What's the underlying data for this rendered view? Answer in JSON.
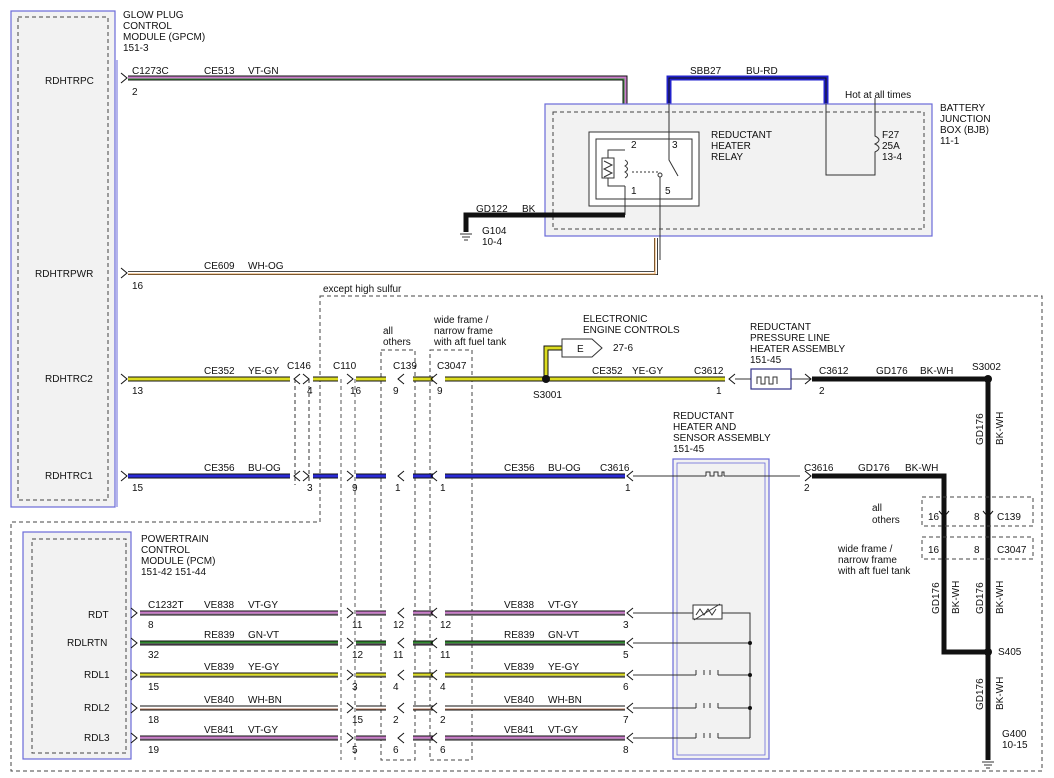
{
  "gpcm": {
    "l1": "GLOW PLUG",
    "l2": "CONTROL",
    "l3": "MODULE (GPCM)",
    "l4": "151-3"
  },
  "pcm": {
    "l1": "POWERTRAIN",
    "l2": "CONTROL",
    "l3": "MODULE (PCM)",
    "l4": "151-42   151-44"
  },
  "bjb": {
    "l1": "BATTERY",
    "l2": "JUNCTION",
    "l3": "BOX (BJB)",
    "l4": "11-1"
  },
  "relay": {
    "l1": "REDUCTANT",
    "l2": "HEATER",
    "l3": "RELAY",
    "p2": "2",
    "p3": "3",
    "p1": "1",
    "p5": "5"
  },
  "fuse": {
    "l1": "F27",
    "l2": "25A",
    "l3": "13-4"
  },
  "hot": "Hot at all times",
  "sbb": {
    "circuit": "SBB27",
    "color": "BU-RD"
  },
  "gd122": {
    "circuit": "GD122",
    "color": "BK"
  },
  "g104": {
    "l1": "G104",
    "l2": "10-4"
  },
  "pins": {
    "rdhtrpc": "RDHTRPC",
    "rdhtrpwr": "RDHTRPWR",
    "rdhtrc2": "RDHTRC2",
    "rdhtrc1": "RDHTRC1",
    "rdt": "RDT",
    "rdlrtn": "RDLRTN",
    "rdl1": "RDL1",
    "rdl2": "RDL2",
    "rdl3": "RDL3"
  },
  "w_ce513": {
    "conn": "C1273C",
    "circuit": "CE513",
    "color": "VT-GN",
    "pin": "2"
  },
  "w_ce609": {
    "circuit": "CE609",
    "color": "WH-OG",
    "pin": "16"
  },
  "except": "except high sulfur",
  "allothers": {
    "l1": "all",
    "l2": "others"
  },
  "wideframe": {
    "l1": "wide frame /",
    "l2": "narrow frame",
    "l3": "with aft fuel tank"
  },
  "eec": {
    "l1": "ELECTRONIC",
    "l2": "ENGINE CONTROLS",
    "ref": "27-6",
    "letter": "E"
  },
  "rplh": {
    "l1": "REDUCTANT",
    "l2": "PRESSURE LINE",
    "l3": "HEATER ASSEMBLY",
    "l4": "151-45"
  },
  "rhsa": {
    "l1": "REDUCTANT",
    "l2": "HEATER AND",
    "l3": "SENSOR ASSEMBLY",
    "l4": "151-45"
  },
  "c2": {
    "circuit": "CE352",
    "color": "YE-GY",
    "p13": "13",
    "c146": "C146",
    "p4": "4",
    "c110": "C110",
    "p16": "16",
    "c139": "C139",
    "p9a": "9",
    "c3047": "C3047",
    "p9b": "9",
    "s3001": "S3001",
    "circuit2": "CE352",
    "color2": "YE-GY",
    "c3612": "C3612",
    "p1": "1",
    "c3612b": "C3612",
    "p2": "2",
    "gd176": "GD176",
    "bkwh": "BK-WH",
    "s3002": "S3002"
  },
  "c1": {
    "circuit": "CE356",
    "color": "BU-OG",
    "p15": "15",
    "p3": "3",
    "p9": "9",
    "p1a": "1",
    "p1b": "1",
    "circuit2": "CE356",
    "color2": "BU-OG",
    "c3616": "C3616",
    "p1c": "1",
    "c3616b": "C3616",
    "p2": "2",
    "gd176": "GD176",
    "bkwh": "BK-WH"
  },
  "right": {
    "allothers1": "all",
    "allothers2": "others",
    "p16a": "16",
    "p8a": "8",
    "c139": "C139",
    "p16b": "16",
    "p8b": "8",
    "c3047": "C3047",
    "wf1": "wide frame /",
    "wf2": "narrow frame",
    "wf3": "with aft fuel tank",
    "gd176a": "GD176",
    "bkwha": "BK-WH",
    "gd176b": "GD176",
    "bkwhb": "BK-WH",
    "gd176c": "GD176",
    "bkwhc": "BK-WH",
    "gd176d": "GD176",
    "bkwhd": "BK-WH",
    "s405": "S405",
    "g400a": "G400",
    "g400b": "10-15"
  },
  "rdt": {
    "conn": "C1232T",
    "circuit": "VE838",
    "color": "VT-GY",
    "p8": "8",
    "p11": "11",
    "p12a": "12",
    "p12b": "12",
    "circuit2": "VE838",
    "color2": "VT-GY",
    "p3": "3"
  },
  "rdlrtn": {
    "circuit": "RE839",
    "color": "GN-VT",
    "p32": "32",
    "p12": "12",
    "p11a": "11",
    "p11b": "11",
    "circuit2": "RE839",
    "color2": "GN-VT",
    "p5": "5"
  },
  "rdl1": {
    "circuit": "VE839",
    "color": "YE-GY",
    "p15": "15",
    "p3": "3",
    "p4a": "4",
    "p4b": "4",
    "circuit2": "VE839",
    "color2": "YE-GY",
    "p6": "6"
  },
  "rdl2": {
    "circuit": "VE840",
    "color": "WH-BN",
    "p18": "18",
    "p15": "15",
    "p2a": "2",
    "p2b": "2",
    "circuit2": "VE840",
    "color2": "WH-BN",
    "p7": "7"
  },
  "rdl3": {
    "circuit": "VE841",
    "color": "VT-GY",
    "p19": "19",
    "p5": "5",
    "p6a": "6",
    "p6b": "6",
    "circuit2": "VE841",
    "color2": "VT-GY",
    "p8": "8"
  }
}
